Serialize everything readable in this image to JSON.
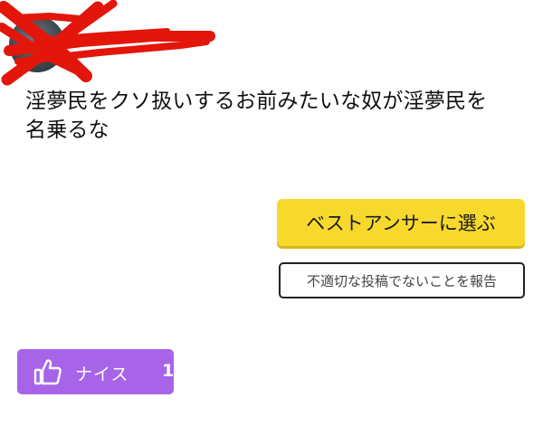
{
  "user": {
    "name": ""
  },
  "answer": {
    "line1": "淫夢民をクソ扱いするお前みたいな奴が淫夢民を",
    "line2": "名乗るな"
  },
  "actions": {
    "best_answer_label": "ベストアンサーに選ぶ",
    "report_label": "不適切な投稿でないことを報告",
    "nice_label": "ナイス",
    "nice_count": "1"
  },
  "colors": {
    "best_answer_bg": "#f7d92e",
    "nice_bg": "#a864e8",
    "redaction": "#e3160b"
  },
  "icons": {
    "nice": "thumbs-up-icon"
  }
}
